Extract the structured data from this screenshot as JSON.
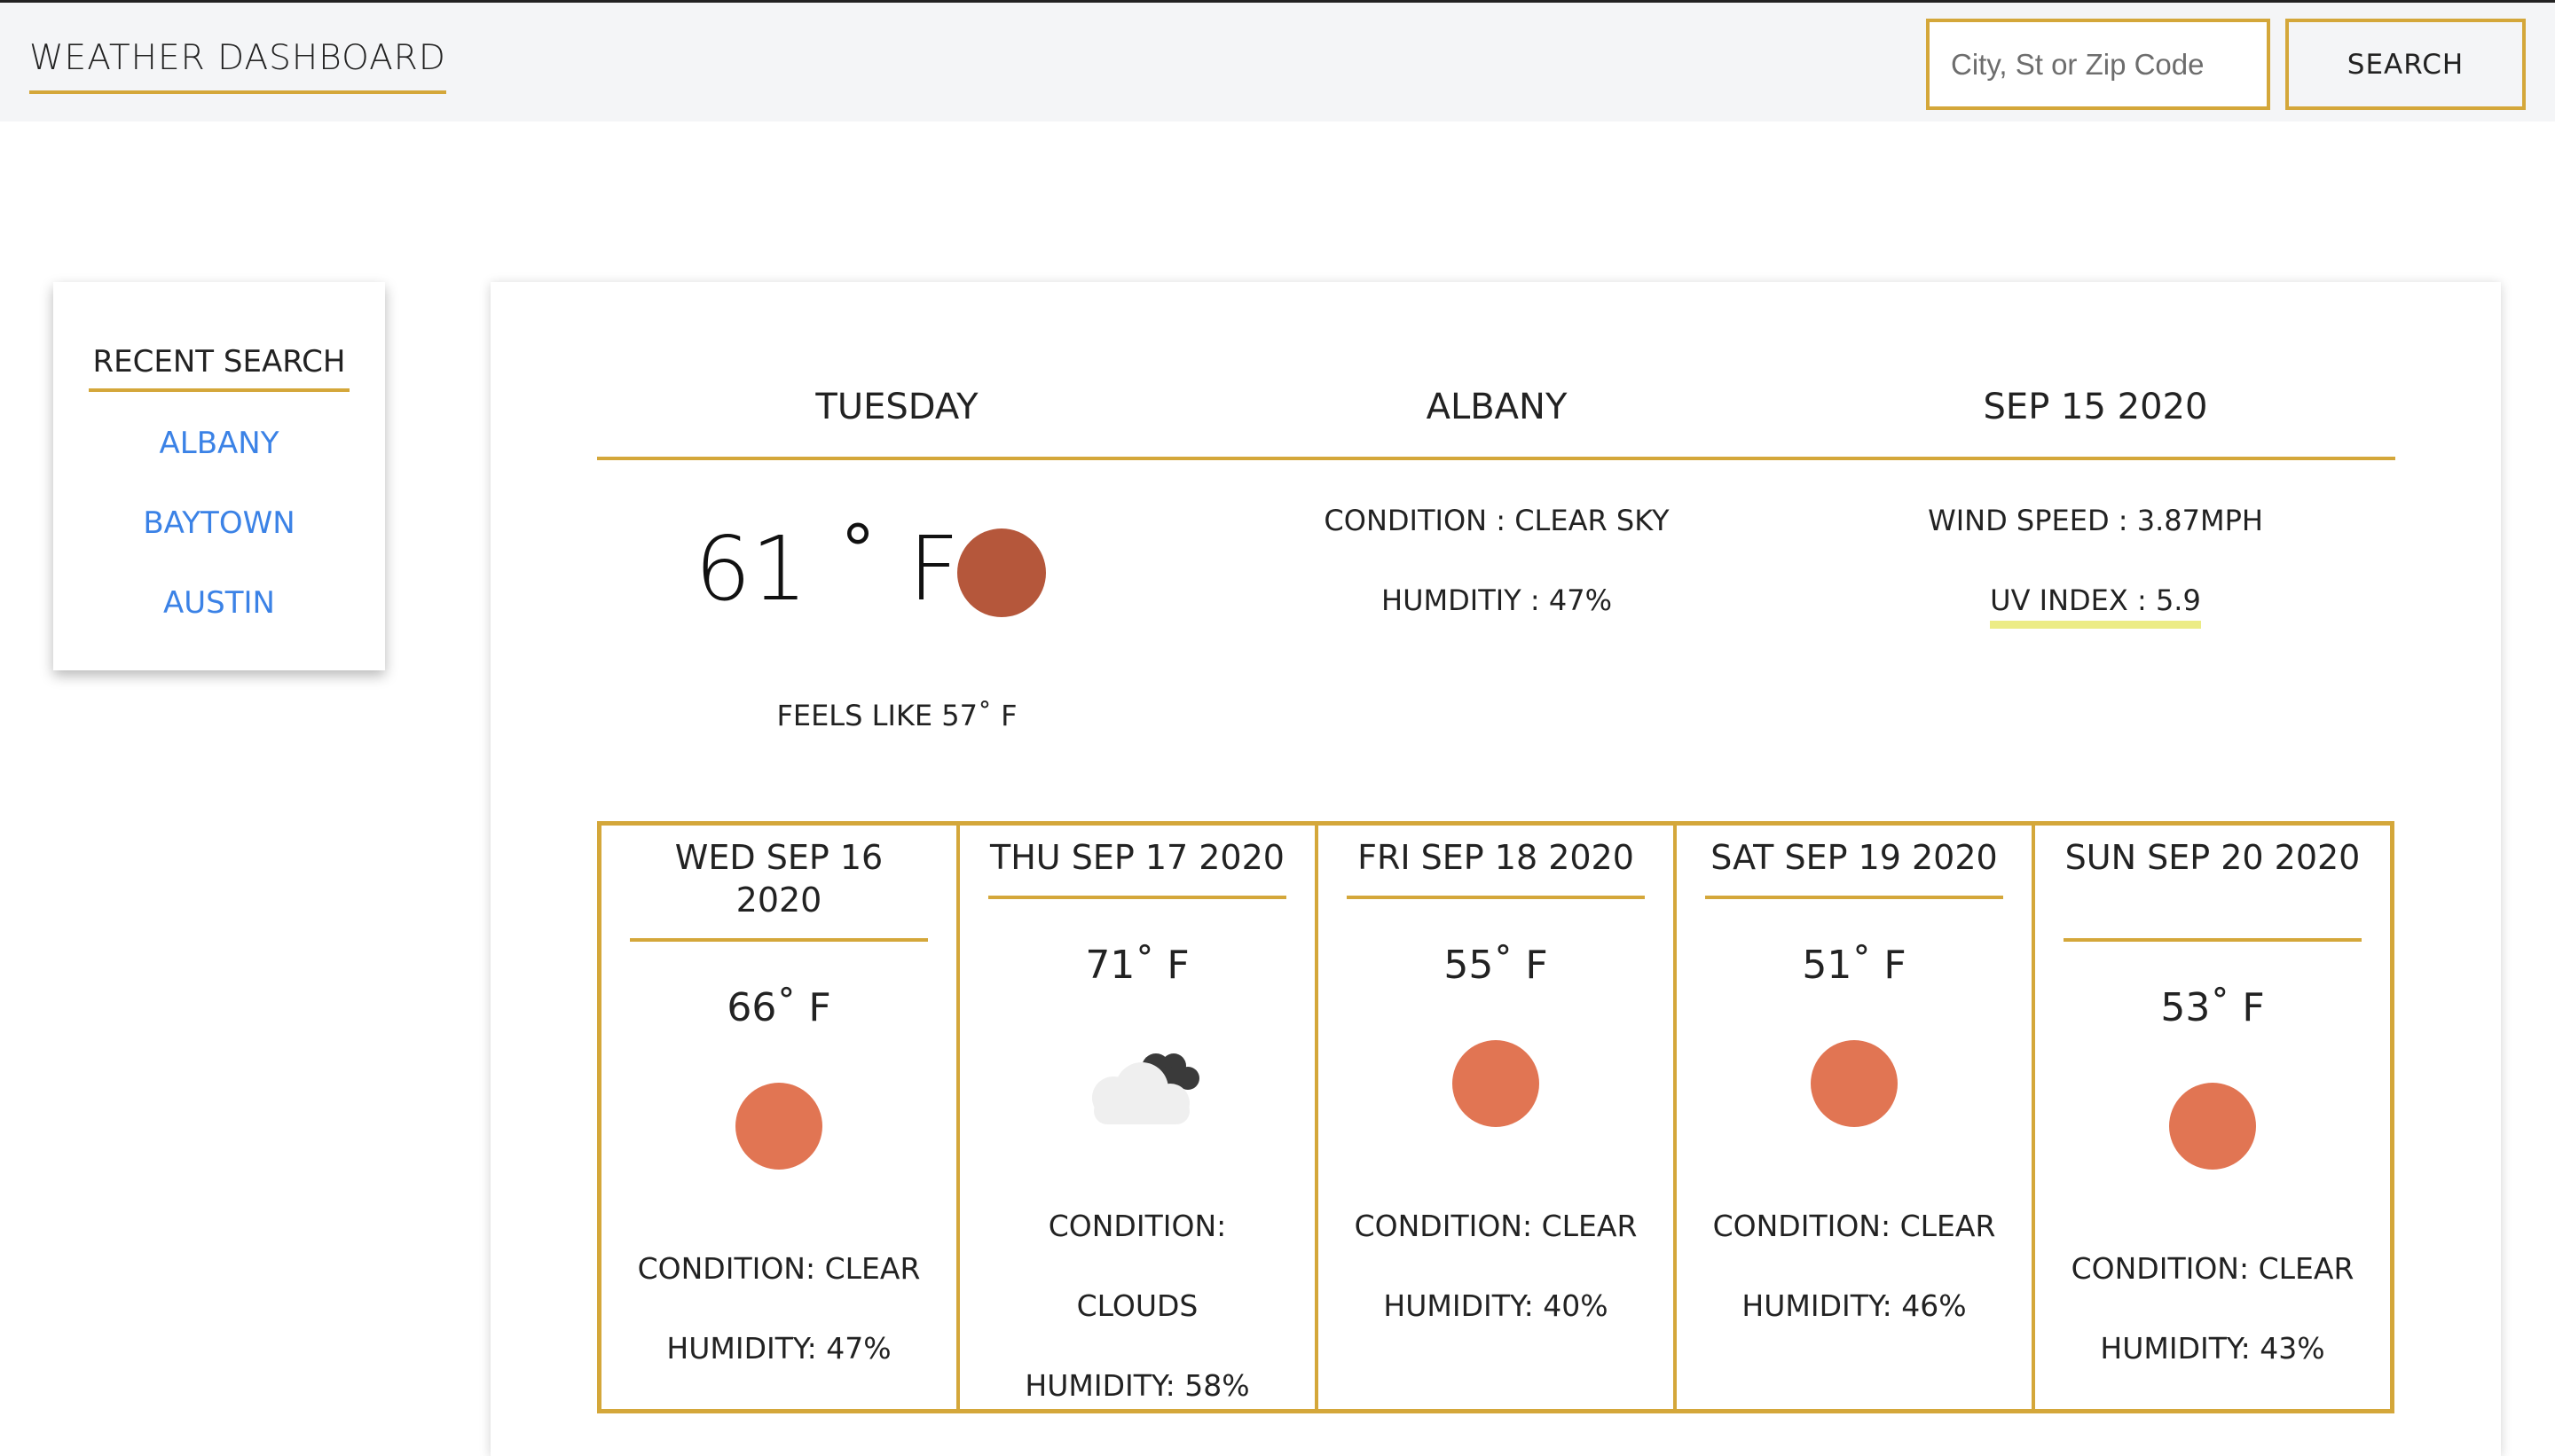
{
  "header": {
    "title": "WEATHER DASHBOARD",
    "search_placeholder": "City, St or Zip Code",
    "search_button": "SEARCH"
  },
  "recent": {
    "title": "RECENT SEARCH",
    "items": [
      "ALBANY",
      "BAYTOWN",
      "AUSTIN"
    ]
  },
  "current": {
    "day": "TUESDAY",
    "city": "ALBANY",
    "date": "SEP 15 2020",
    "temp": "61 ˚ F",
    "icon": "sun-icon",
    "feels_like": "FEELS LIKE 57˚ F",
    "condition": "CONDITION : CLEAR SKY",
    "humidity": "HUMDITIY : 47%",
    "wind": "WIND SPEED : 3.87MPH",
    "uv": "UV INDEX : 5.9"
  },
  "forecast": [
    {
      "date": "WED SEP 16 2020",
      "temp": "66˚ F",
      "icon": "sun-icon",
      "condition": "CONDITION: CLEAR",
      "humidity": "HUMIDITY: 47%"
    },
    {
      "date": "THU SEP 17 2020",
      "temp": "71˚ F",
      "icon": "clouds-icon",
      "condition": "CONDITION:",
      "condition2": "CLOUDS",
      "humidity": "HUMIDITY: 58%"
    },
    {
      "date": "FRI SEP 18 2020",
      "temp": "55˚ F",
      "icon": "sun-icon",
      "condition": "CONDITION: CLEAR",
      "humidity": "HUMIDITY: 40%"
    },
    {
      "date": "SAT SEP 19 2020",
      "temp": "51˚ F",
      "icon": "sun-icon",
      "condition": "CONDITION: CLEAR",
      "humidity": "HUMIDITY: 46%"
    },
    {
      "date": "SUN SEP 20 2020",
      "temp": "53˚ F",
      "icon": "sun-icon",
      "condition": "CONDITION: CLEAR",
      "humidity": "HUMIDITY: 43%"
    }
  ],
  "colors": {
    "accent": "#d4a73a",
    "link": "#3b82e6",
    "current_sun": "#b5573b",
    "forecast_sun": "#e17553",
    "uv_highlight": "#ecec86"
  }
}
